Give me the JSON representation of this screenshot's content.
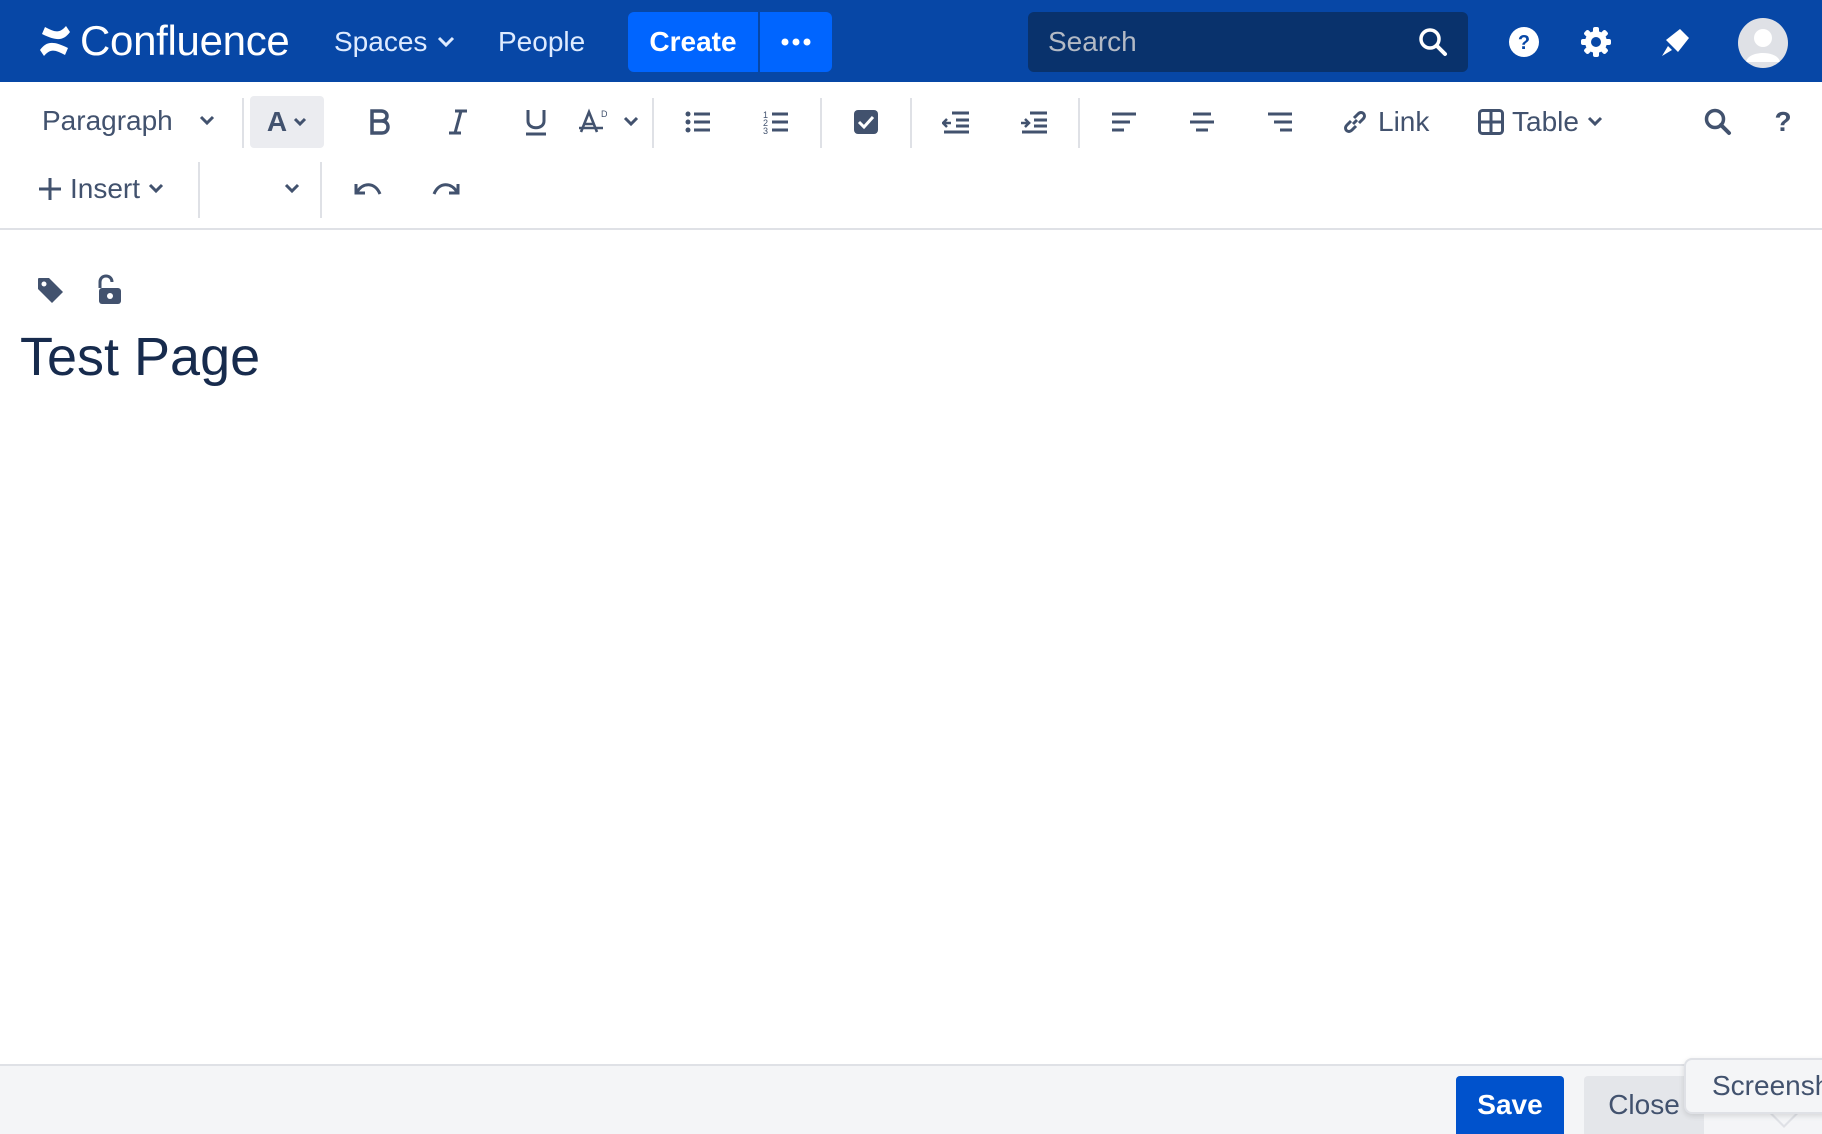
{
  "colors": {
    "nav_bg": "#0747a6",
    "create_bg": "#0065ff",
    "search_bg": "#09326c",
    "save_bg": "#0052cc",
    "text": "#172b4d",
    "toolbar_icon": "#42526e"
  },
  "topnav": {
    "logo_text": "Confluence",
    "spaces_label": "Spaces",
    "people_label": "People",
    "create_label": "Create",
    "more_label": "•••",
    "search_placeholder": "Search",
    "icons": [
      "help-icon",
      "gear-icon",
      "notifications-icon",
      "avatar"
    ]
  },
  "toolbar": {
    "paragraph_label": "Paragraph",
    "text_color_label": "A",
    "link_label": "Link",
    "table_label": "Table",
    "insert_label": "Insert",
    "help_label": "?",
    "icons": [
      "bold-icon",
      "italic-icon",
      "underline-icon",
      "clear-formatting-icon",
      "bullet-list-icon",
      "numbered-list-icon",
      "task-list-icon",
      "outdent-icon",
      "indent-icon",
      "align-left-icon",
      "align-center-icon",
      "align-right-icon",
      "link-icon",
      "table-icon",
      "find-replace-icon",
      "undo-icon",
      "redo-icon"
    ]
  },
  "content": {
    "title": "Test Page",
    "meta_icons": [
      "label-icon",
      "restrictions-unlocked-icon"
    ]
  },
  "footer": {
    "save_label": "Save",
    "close_label": "Close",
    "tooltip_text": "Screensh"
  }
}
